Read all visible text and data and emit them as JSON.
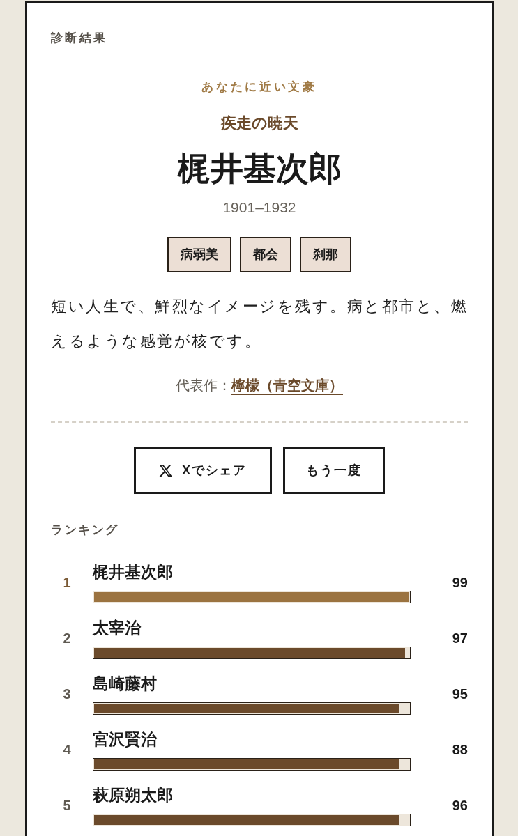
{
  "header": {
    "label": "診断結果"
  },
  "result": {
    "eyebrow": "あなたに近い文豪",
    "type_name": "疾走の暁天",
    "author": "梶井基次郎",
    "years": "1901–1932",
    "tags": [
      "病弱美",
      "都会",
      "刹那"
    ],
    "description": "短い人生で、鮮烈なイメージを残す。病と都市と、燃えるような感覚が核です。",
    "representative_work": {
      "label": "代表作：",
      "link": "檸檬（青空文庫）"
    }
  },
  "actions": [
    {
      "kind": "share",
      "label": "Xでシェア"
    },
    {
      "kind": "retry",
      "label": "もう一度"
    }
  ],
  "ranking": {
    "title": "ランキング",
    "rows": [
      {
        "rank": "1",
        "name": "梶井基次郎",
        "score": "99",
        "level": 1.0,
        "selected": true
      },
      {
        "rank": "2",
        "name": "太宰治",
        "score": "97",
        "level": 0.987,
        "selected": false
      },
      {
        "rank": "3",
        "name": "島崎藤村",
        "score": "95",
        "level": 0.967,
        "selected": false
      },
      {
        "rank": "4",
        "name": "宮沢賢治",
        "score": "88",
        "level": 0.967,
        "selected": false
      },
      {
        "rank": "5",
        "name": "萩原朔太郎",
        "score": "96",
        "level": 0.967,
        "selected": false
      }
    ]
  }
}
